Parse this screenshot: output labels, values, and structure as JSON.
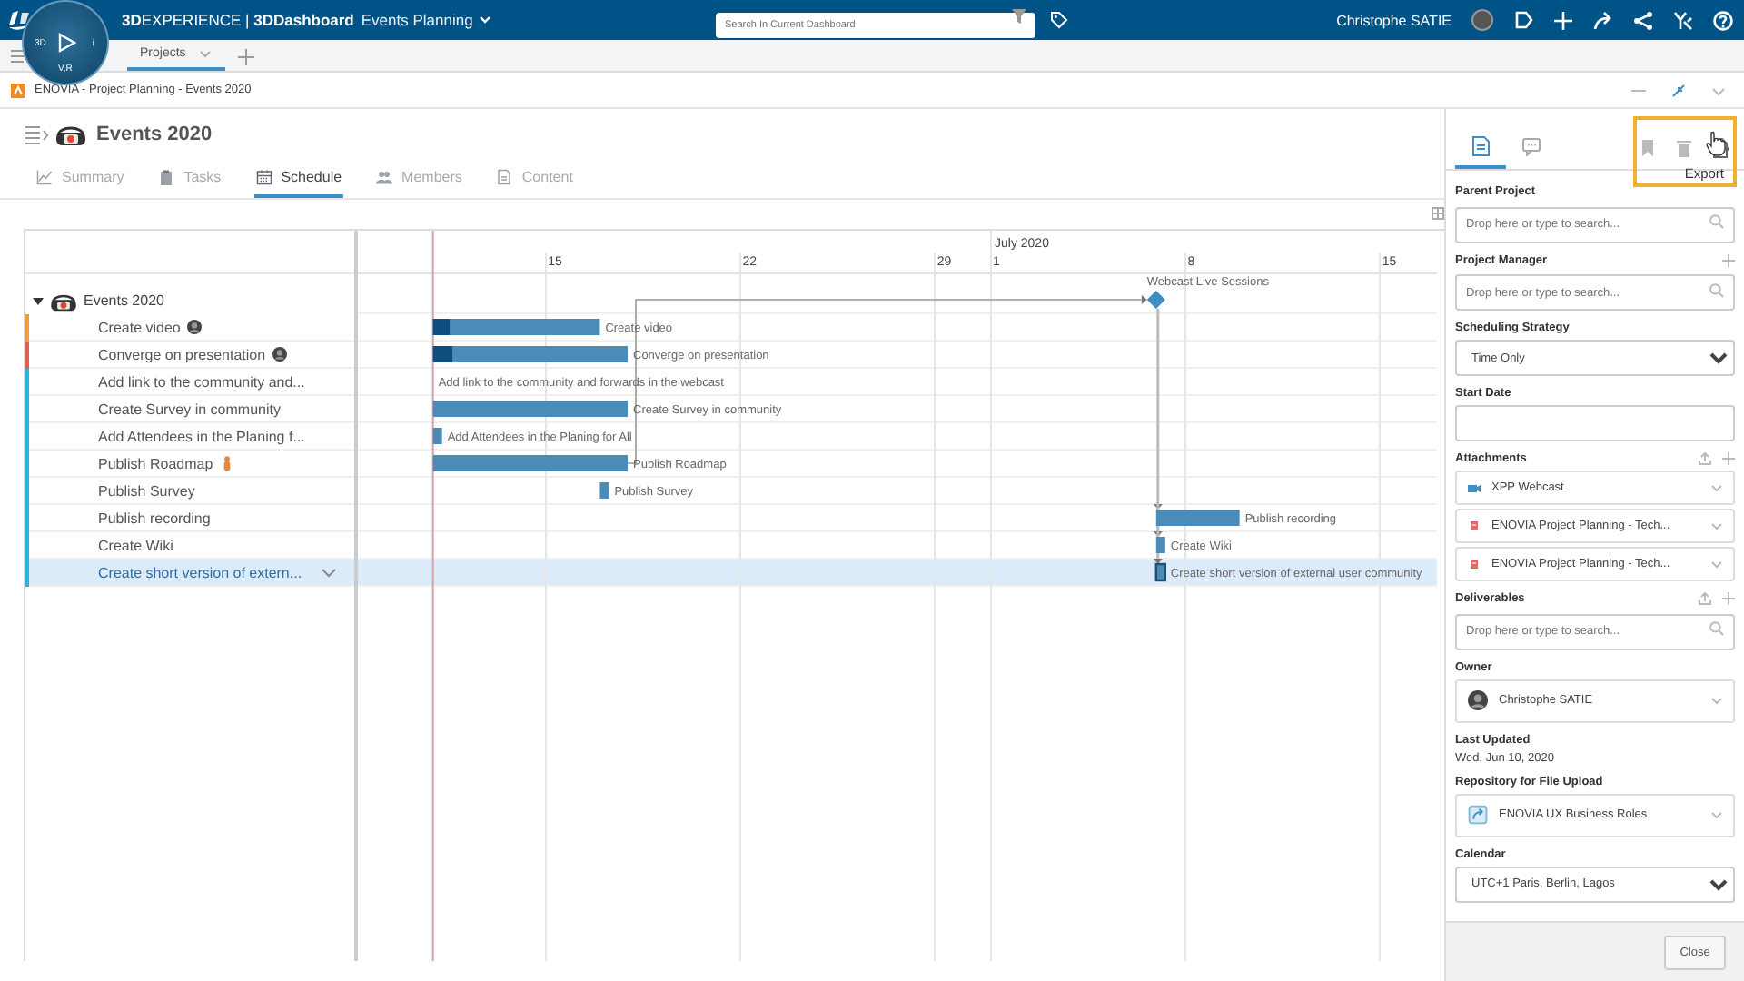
{
  "top_bar": {
    "brand": "**3D**EXPERIENCE | **3DDashboard**",
    "dashboard": "Events Planning",
    "compass_labels": [
      "3D",
      "i",
      "V,R"
    ],
    "search": {
      "placeholder": "Search In Current Dashboard"
    },
    "user": "Christophe SATIE"
  },
  "dashboard_tabs": [
    {
      "label": "Projects",
      "selected": true
    }
  ],
  "widget": {
    "title": "ENOVIA - Project Planning - Events 2020"
  },
  "project": {
    "title": "Events 2020",
    "tabs": [
      {
        "label": "Summary",
        "kind": "summary",
        "selected": false
      },
      {
        "label": "Tasks",
        "kind": "tasks",
        "selected": false
      },
      {
        "label": "Schedule",
        "kind": "schedule",
        "selected": true
      },
      {
        "label": "Members",
        "kind": "members",
        "selected": false
      },
      {
        "label": "Content",
        "kind": "content",
        "selected": false
      }
    ]
  },
  "gantt": {
    "root": {
      "name": "Events 2020",
      "expanded": true
    },
    "tasks": [
      {
        "name": "Create video",
        "color": "#f39c3c",
        "assignee": {
          "kind": "photo"
        },
        "kind": "bar",
        "level": 0.1,
        "precedes_milestone": false,
        "follows_milestone": false,
        "selected": false
      },
      {
        "name": "Converge on presentation",
        "color": "#e2604f",
        "assignee": {
          "kind": "photo"
        },
        "kind": "bar",
        "level": 0.1,
        "precedes_milestone": false,
        "follows_milestone": false,
        "selected": false
      },
      {
        "name": "Add link to the community and...",
        "color": "#27b5de",
        "kind": "none",
        "precedes_milestone": false,
        "follows_milestone": false,
        "selected": false
      },
      {
        "name": "Create Survey in community",
        "color": "#27b5de",
        "kind": "bar",
        "precedes_milestone": false,
        "follows_milestone": false,
        "selected": false
      },
      {
        "name": "Add Attendees in the Planing f...",
        "color": "#27b5de",
        "kind": "bar",
        "precedes_milestone": false,
        "follows_milestone": false,
        "selected": false
      },
      {
        "name": "Publish Roadmap",
        "color": "#27b5de",
        "assignee": {
          "kind": "figure"
        },
        "kind": "bar",
        "precedes_milestone": true,
        "follows_milestone": false,
        "selected": false
      },
      {
        "name": "Publish Survey",
        "color": "#27b5de",
        "kind": "bar",
        "precedes_milestone": false,
        "follows_milestone": false,
        "selected": false
      },
      {
        "name": "Publish recording",
        "color": "#27b5de",
        "kind": "bar",
        "precedes_milestone": false,
        "follows_milestone": true,
        "selected": false
      },
      {
        "name": "Create Wiki",
        "color": "#27b5de",
        "kind": "bar",
        "precedes_milestone": false,
        "follows_milestone": true,
        "selected": false
      },
      {
        "name": "Create short version of extern...",
        "color": "#27b5de",
        "kind": "bar",
        "precedes_milestone": false,
        "follows_milestone": true,
        "selected": true
      }
    ],
    "timeline": {
      "month": "July 2020",
      "ticks": [
        "15",
        "22",
        "29",
        "1",
        "8",
        "15"
      ],
      "milestone": "Webcast Live Sessions",
      "bar_labels": [
        "Create video",
        "Converge on presentation",
        "Add link to the community and forwards in the webcast",
        "Create Survey in community",
        "Add Attendees in the Planing for All",
        "Publish Roadmap",
        "Publish Survey",
        "Publish recording",
        "Create Wiki",
        "Create short version of external user community"
      ]
    }
  },
  "panel": {
    "tabs": [
      {
        "kind": "properties",
        "selected": true
      },
      {
        "kind": "comments",
        "selected": false
      }
    ],
    "tools": [
      {
        "kind": "bookmark",
        "highlighted": false
      },
      {
        "kind": "delete",
        "highlighted": false
      },
      {
        "kind": "export",
        "highlighted": true,
        "tooltip": "Export"
      }
    ],
    "fields": [
      {
        "label": "Parent Project",
        "kind": "search",
        "placeholder": "Drop here or type to search...",
        "can_add": false,
        "can_upload": false
      },
      {
        "label": "Project Manager",
        "kind": "search",
        "placeholder": "Drop here or type to search...",
        "can_add": true,
        "can_upload": false
      },
      {
        "label": "Scheduling Strategy",
        "kind": "select",
        "value": "Time Only",
        "can_add": false,
        "can_upload": false
      },
      {
        "label": "Start Date",
        "kind": "input",
        "can_add": false,
        "can_upload": false
      },
      {
        "label": "Attachments",
        "kind": "items",
        "can_add": true,
        "can_upload": true,
        "items": [
          {
            "name": "XPP Webcast",
            "kind": "media"
          },
          {
            "name": "ENOVIA Project Planning - Tech...",
            "kind": "file"
          },
          {
            "name": "ENOVIA Project Planning - Tech...",
            "kind": "file"
          }
        ]
      },
      {
        "label": "Deliverables",
        "kind": "search",
        "placeholder": "Drop here or type to search...",
        "can_add": true,
        "can_upload": true
      },
      {
        "label": "Owner",
        "kind": "items",
        "can_add": false,
        "can_upload": false,
        "items": [
          {
            "name": "Christophe SATIE",
            "kind": "person"
          }
        ]
      },
      {
        "label": "Last Updated",
        "kind": "text",
        "value": "Wed, Jun 10, 2020",
        "can_add": false,
        "can_upload": false
      },
      {
        "label": "Repository for File Upload",
        "kind": "items",
        "can_add": false,
        "can_upload": false,
        "items": [
          {
            "name": "ENOVIA UX Business Roles",
            "kind": "repository"
          }
        ]
      },
      {
        "label": "Calendar",
        "kind": "select",
        "value": "UTC+1 Paris, Berlin, Lagos",
        "can_add": false,
        "can_upload": false
      }
    ],
    "close": "Close"
  }
}
